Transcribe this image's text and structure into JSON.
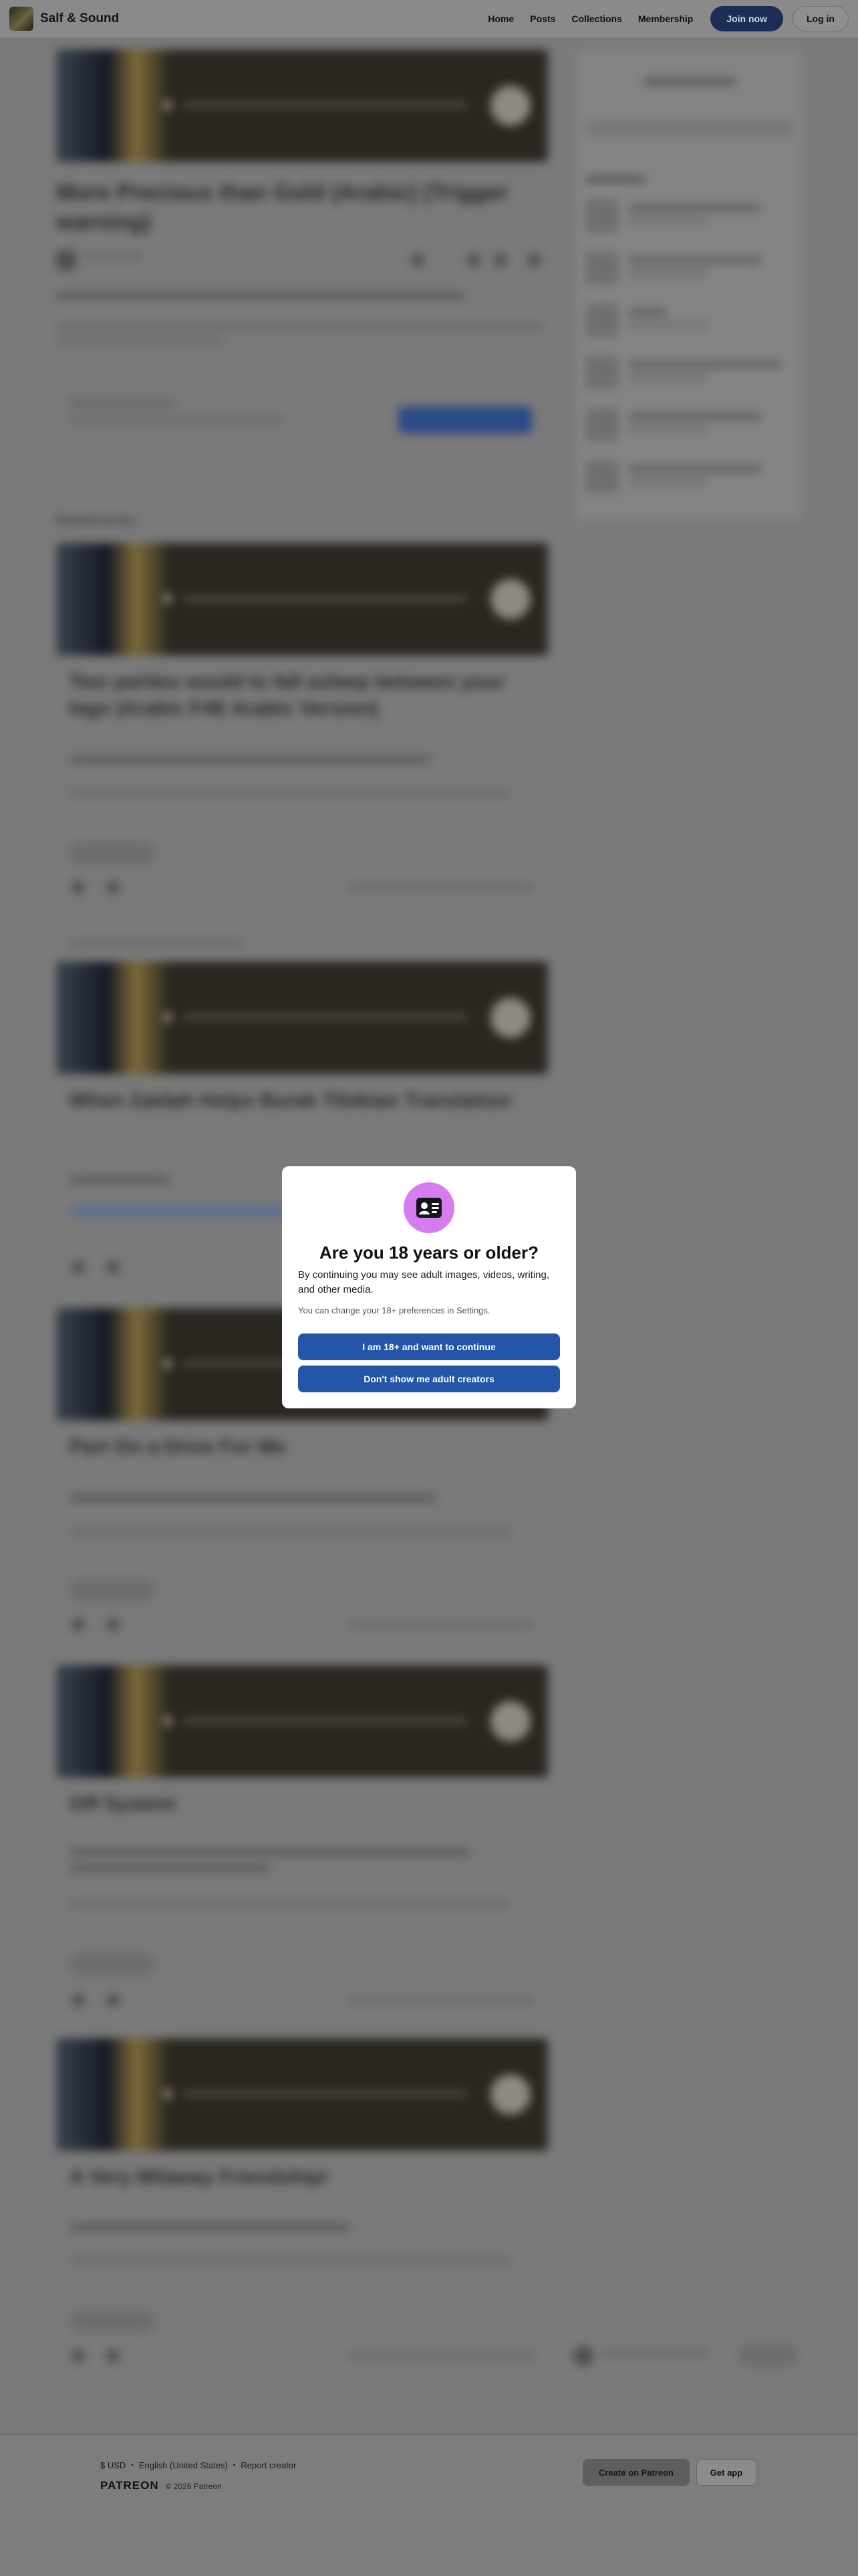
{
  "header": {
    "brand": "Salf & Sound",
    "nav": {
      "home": "Home",
      "posts": "Posts",
      "collections": "Collections",
      "membership": "Membership"
    },
    "join_label": "Join now",
    "login_label": "Log in"
  },
  "background_posts": {
    "main_title": "More Precious than Gold (Arabic) (Trigger warning)",
    "section_label": "Related posts",
    "post_titles": [
      "Two parties would to fall asleep between your legs (Arabic F4E Arabic Version)",
      "When Zaidah Helps Burak Tibibian Translation",
      "Part On a Drive For Me",
      "Off System",
      "A Very Milaway Friendship!"
    ]
  },
  "modal": {
    "icon": "id-card-icon",
    "title": "Are you 18 years or older?",
    "body": "By continuing you may see adult images, videos, writing, and other media.",
    "note": "You can change your 18+ preferences in Settings.",
    "confirm_label": "I am 18+ and want to continue",
    "decline_label": "Don't show me adult creators"
  },
  "footer": {
    "currency": "$ USD",
    "language": "English (United States)",
    "report": "Report creator",
    "logo": "PATREON",
    "copyright": "© 2026 Patreon",
    "create_label": "Create on Patreon",
    "getapp_label": "Get app"
  },
  "colors": {
    "modal_button": "#2355a8",
    "modal_icon_bg": "#d67cf1",
    "join_button": "#1c2e55"
  }
}
